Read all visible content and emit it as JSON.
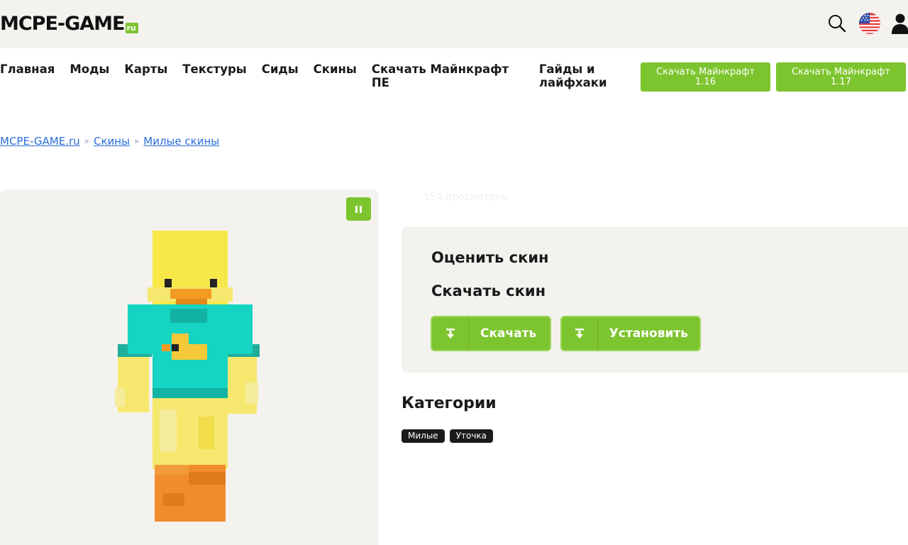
{
  "header": {
    "logo_text": "MCPE-GAME",
    "logo_suffix": "ru",
    "icons": [
      "search-icon",
      "us-flag-icon",
      "user-icon"
    ]
  },
  "nav": {
    "items": [
      {
        "label": "Главная"
      },
      {
        "label": "Моды"
      },
      {
        "label": "Карты"
      },
      {
        "label": "Текстуры"
      },
      {
        "label": "Сиды"
      },
      {
        "label": "Скины"
      },
      {
        "label": "Скачать Майнкрафт ПЕ"
      },
      {
        "label": "Гайды и лайфхаки"
      }
    ],
    "download_buttons": [
      {
        "line1": "Скачать Майнкрафт",
        "line2": "1.16"
      },
      {
        "line1": "Скачать Майнкрафт",
        "line2": "1.17"
      }
    ]
  },
  "breadcrumb": {
    "items": [
      "MCPE-GAME.ru",
      "Скины",
      "Милые скины"
    ],
    "separator": "»"
  },
  "skin": {
    "views": "154 просмотров"
  },
  "panel": {
    "rate_title": "Оценить скин",
    "download_title": "Скачать скин",
    "download_label": "Скачать",
    "install_label": "Установить"
  },
  "categories": {
    "title": "Категории",
    "tags": [
      "Милые",
      "Уточка"
    ]
  },
  "colors": {
    "accent": "#7dc52e",
    "panel_bg": "#f4f2ee",
    "link": "#2a6ed8"
  }
}
